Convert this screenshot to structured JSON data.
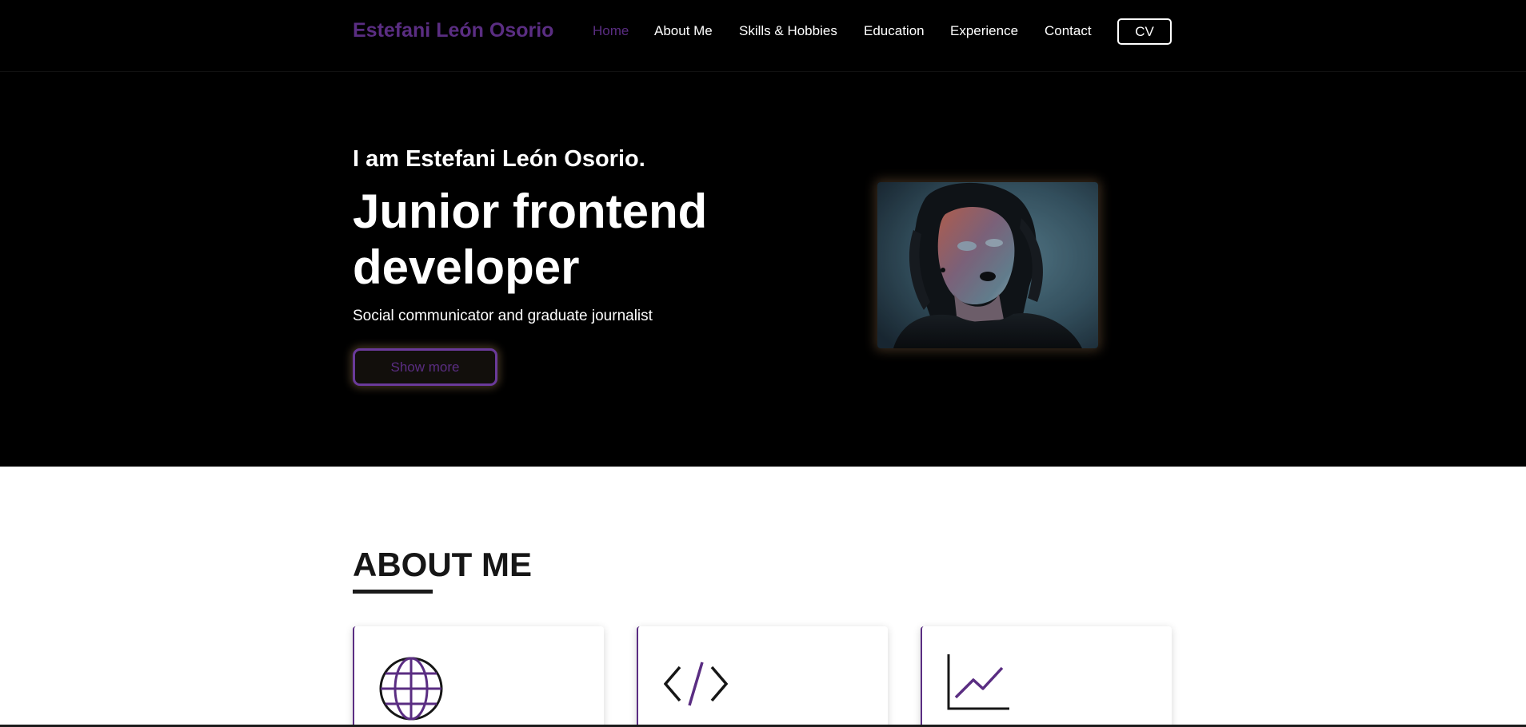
{
  "nav": {
    "brand": "Estefani León Osorio",
    "links": [
      {
        "label": "Home",
        "active": true
      },
      {
        "label": "About Me",
        "active": false
      },
      {
        "label": "Skills & Hobbies",
        "active": false
      },
      {
        "label": "Education",
        "active": false
      },
      {
        "label": "Experience",
        "active": false
      },
      {
        "label": "Contact",
        "active": false
      }
    ],
    "cv_label": "CV"
  },
  "hero": {
    "intro": "I am Estefani León Osorio.",
    "title": "Junior frontend developer",
    "subtitle": "Social communicator and graduate journalist",
    "button_label": "Show more"
  },
  "about": {
    "title": "ABOUT ME",
    "cards": [
      {
        "icon": "globe-icon"
      },
      {
        "icon": "code-icon"
      },
      {
        "icon": "line-chart-icon"
      }
    ]
  },
  "colors": {
    "accent": "#5a2d82",
    "background_dark": "#000000",
    "text_light": "#ffffff",
    "text_dark": "#161616"
  }
}
